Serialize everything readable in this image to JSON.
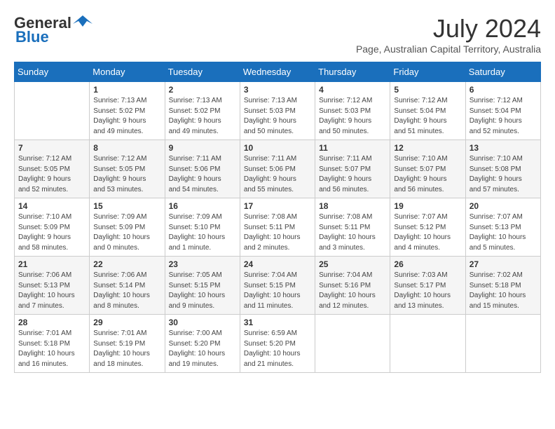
{
  "header": {
    "logo_general": "General",
    "logo_blue": "Blue",
    "month_year": "July 2024",
    "location": "Page, Australian Capital Territory, Australia"
  },
  "days_of_week": [
    "Sunday",
    "Monday",
    "Tuesday",
    "Wednesday",
    "Thursday",
    "Friday",
    "Saturday"
  ],
  "weeks": [
    [
      {
        "day": "",
        "info": ""
      },
      {
        "day": "1",
        "info": "Sunrise: 7:13 AM\nSunset: 5:02 PM\nDaylight: 9 hours\nand 49 minutes."
      },
      {
        "day": "2",
        "info": "Sunrise: 7:13 AM\nSunset: 5:02 PM\nDaylight: 9 hours\nand 49 minutes."
      },
      {
        "day": "3",
        "info": "Sunrise: 7:13 AM\nSunset: 5:03 PM\nDaylight: 9 hours\nand 50 minutes."
      },
      {
        "day": "4",
        "info": "Sunrise: 7:12 AM\nSunset: 5:03 PM\nDaylight: 9 hours\nand 50 minutes."
      },
      {
        "day": "5",
        "info": "Sunrise: 7:12 AM\nSunset: 5:04 PM\nDaylight: 9 hours\nand 51 minutes."
      },
      {
        "day": "6",
        "info": "Sunrise: 7:12 AM\nSunset: 5:04 PM\nDaylight: 9 hours\nand 52 minutes."
      }
    ],
    [
      {
        "day": "7",
        "info": "Sunrise: 7:12 AM\nSunset: 5:05 PM\nDaylight: 9 hours\nand 52 minutes."
      },
      {
        "day": "8",
        "info": "Sunrise: 7:12 AM\nSunset: 5:05 PM\nDaylight: 9 hours\nand 53 minutes."
      },
      {
        "day": "9",
        "info": "Sunrise: 7:11 AM\nSunset: 5:06 PM\nDaylight: 9 hours\nand 54 minutes."
      },
      {
        "day": "10",
        "info": "Sunrise: 7:11 AM\nSunset: 5:06 PM\nDaylight: 9 hours\nand 55 minutes."
      },
      {
        "day": "11",
        "info": "Sunrise: 7:11 AM\nSunset: 5:07 PM\nDaylight: 9 hours\nand 56 minutes."
      },
      {
        "day": "12",
        "info": "Sunrise: 7:10 AM\nSunset: 5:07 PM\nDaylight: 9 hours\nand 56 minutes."
      },
      {
        "day": "13",
        "info": "Sunrise: 7:10 AM\nSunset: 5:08 PM\nDaylight: 9 hours\nand 57 minutes."
      }
    ],
    [
      {
        "day": "14",
        "info": "Sunrise: 7:10 AM\nSunset: 5:09 PM\nDaylight: 9 hours\nand 58 minutes."
      },
      {
        "day": "15",
        "info": "Sunrise: 7:09 AM\nSunset: 5:09 PM\nDaylight: 10 hours\nand 0 minutes."
      },
      {
        "day": "16",
        "info": "Sunrise: 7:09 AM\nSunset: 5:10 PM\nDaylight: 10 hours\nand 1 minute."
      },
      {
        "day": "17",
        "info": "Sunrise: 7:08 AM\nSunset: 5:11 PM\nDaylight: 10 hours\nand 2 minutes."
      },
      {
        "day": "18",
        "info": "Sunrise: 7:08 AM\nSunset: 5:11 PM\nDaylight: 10 hours\nand 3 minutes."
      },
      {
        "day": "19",
        "info": "Sunrise: 7:07 AM\nSunset: 5:12 PM\nDaylight: 10 hours\nand 4 minutes."
      },
      {
        "day": "20",
        "info": "Sunrise: 7:07 AM\nSunset: 5:13 PM\nDaylight: 10 hours\nand 5 minutes."
      }
    ],
    [
      {
        "day": "21",
        "info": "Sunrise: 7:06 AM\nSunset: 5:13 PM\nDaylight: 10 hours\nand 7 minutes."
      },
      {
        "day": "22",
        "info": "Sunrise: 7:06 AM\nSunset: 5:14 PM\nDaylight: 10 hours\nand 8 minutes."
      },
      {
        "day": "23",
        "info": "Sunrise: 7:05 AM\nSunset: 5:15 PM\nDaylight: 10 hours\nand 9 minutes."
      },
      {
        "day": "24",
        "info": "Sunrise: 7:04 AM\nSunset: 5:15 PM\nDaylight: 10 hours\nand 11 minutes."
      },
      {
        "day": "25",
        "info": "Sunrise: 7:04 AM\nSunset: 5:16 PM\nDaylight: 10 hours\nand 12 minutes."
      },
      {
        "day": "26",
        "info": "Sunrise: 7:03 AM\nSunset: 5:17 PM\nDaylight: 10 hours\nand 13 minutes."
      },
      {
        "day": "27",
        "info": "Sunrise: 7:02 AM\nSunset: 5:18 PM\nDaylight: 10 hours\nand 15 minutes."
      }
    ],
    [
      {
        "day": "28",
        "info": "Sunrise: 7:01 AM\nSunset: 5:18 PM\nDaylight: 10 hours\nand 16 minutes."
      },
      {
        "day": "29",
        "info": "Sunrise: 7:01 AM\nSunset: 5:19 PM\nDaylight: 10 hours\nand 18 minutes."
      },
      {
        "day": "30",
        "info": "Sunrise: 7:00 AM\nSunset: 5:20 PM\nDaylight: 10 hours\nand 19 minutes."
      },
      {
        "day": "31",
        "info": "Sunrise: 6:59 AM\nSunset: 5:20 PM\nDaylight: 10 hours\nand 21 minutes."
      },
      {
        "day": "",
        "info": ""
      },
      {
        "day": "",
        "info": ""
      },
      {
        "day": "",
        "info": ""
      }
    ]
  ]
}
